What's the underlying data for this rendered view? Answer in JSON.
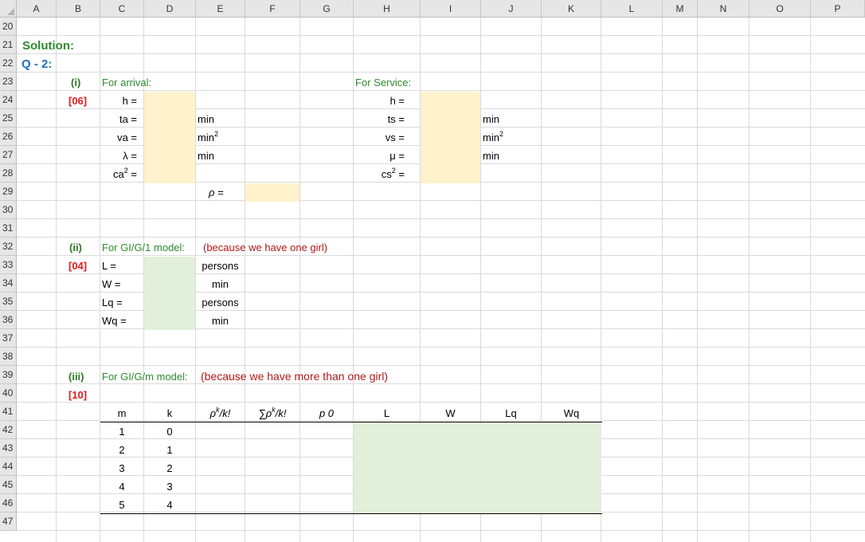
{
  "columns": [
    "A",
    "B",
    "C",
    "D",
    "E",
    "F",
    "G",
    "H",
    "I",
    "J",
    "K",
    "L",
    "M",
    "N",
    "O",
    "P"
  ],
  "rows": [
    "20",
    "21",
    "22",
    "23",
    "24",
    "25",
    "26",
    "27",
    "28",
    "29",
    "30",
    "31",
    "32",
    "33",
    "34",
    "35",
    "36",
    "37",
    "38",
    "39",
    "40",
    "41",
    "42",
    "43",
    "44",
    "45",
    "46",
    "47"
  ],
  "solution_label": "Solution:",
  "question_label": "Q - 2:",
  "part_i": {
    "label": "(i)",
    "marks": "[06]",
    "arrival_title": "For arrival:",
    "arrival_rows": [
      {
        "lbl": "h =",
        "unit": "",
        "sup": ""
      },
      {
        "lbl": "ta =",
        "unit": "min",
        "sup": ""
      },
      {
        "lbl": "va =",
        "unit": "min",
        "sup": "2"
      },
      {
        "lbl": "λ =",
        "unit": "min",
        "sup": ""
      },
      {
        "lbl": "ca",
        "lblsup": "2",
        "lblsuffix": " =",
        "unit": "",
        "sup": ""
      }
    ],
    "service_title": "For Service:",
    "service_rows": [
      {
        "lbl": "h =",
        "unit": "",
        "sup": ""
      },
      {
        "lbl": "ts =",
        "unit": "min",
        "sup": ""
      },
      {
        "lbl": "vs =",
        "unit": "min",
        "sup": "2"
      },
      {
        "lbl": "μ  =",
        "unit": "min",
        "sup": ""
      },
      {
        "lbl": "cs",
        "lblsup": "2",
        "lblsuffix": " =",
        "unit": "",
        "sup": ""
      }
    ],
    "rho_label": "ρ ="
  },
  "part_ii": {
    "label": "(ii)",
    "marks": "[04]",
    "model": "For GI/G/1 model:",
    "reason": "(because we have one girl)",
    "rows": [
      {
        "lbl": "L =",
        "unit": "persons"
      },
      {
        "lbl": "W =",
        "unit": "min"
      },
      {
        "lbl": "Lq =",
        "unit": "persons"
      },
      {
        "lbl": "Wq =",
        "unit": "min"
      }
    ]
  },
  "part_iii": {
    "label": "(iii)",
    "marks": "[10]",
    "model": "For GI/G/m model:",
    "reason": "(because we have more than one girl)",
    "headers": {
      "m": "m",
      "k": "k",
      "pk_base": "ρ",
      "pk_sup": "k",
      "pk_tail": "/k!",
      "sum_base": "∑ρ",
      "sum_sup": "k",
      "sum_tail": "/k!",
      "p0": "p 0",
      "L": "L",
      "W": "W",
      "Lq": "Lq",
      "Wq": "Wq"
    },
    "table_rows": [
      {
        "m": "1",
        "k": "0"
      },
      {
        "m": "2",
        "k": "1"
      },
      {
        "m": "3",
        "k": "2"
      },
      {
        "m": "4",
        "k": "3"
      },
      {
        "m": "5",
        "k": "4"
      }
    ]
  },
  "colors": {
    "input_fill": "#fff2cc",
    "output_fill": "#e2efda",
    "green_text": "#2e8b2e",
    "red_text": "#e21b1b",
    "blue_text": "#1f6fbf"
  }
}
